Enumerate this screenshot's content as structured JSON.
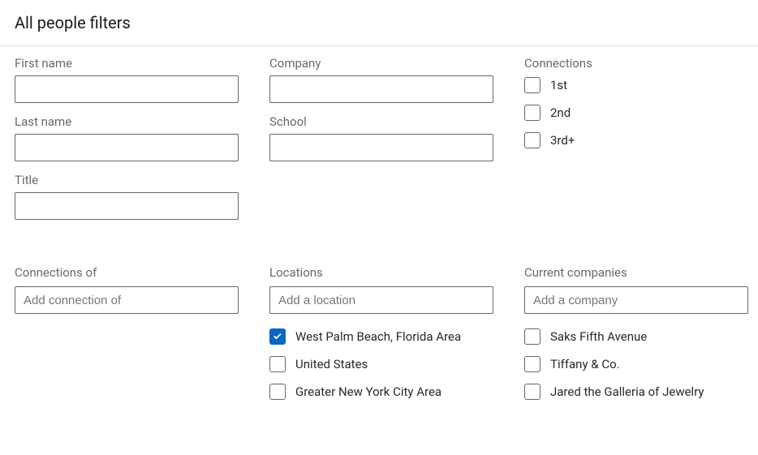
{
  "header": {
    "title": "All people filters"
  },
  "fields": {
    "first_name": {
      "label": "First name",
      "value": ""
    },
    "last_name": {
      "label": "Last name",
      "value": ""
    },
    "title": {
      "label": "Title",
      "value": ""
    },
    "company": {
      "label": "Company",
      "value": ""
    },
    "school": {
      "label": "School",
      "value": ""
    }
  },
  "connections": {
    "heading": "Connections",
    "options": [
      {
        "label": "1st",
        "checked": false
      },
      {
        "label": "2nd",
        "checked": false
      },
      {
        "label": "3rd+",
        "checked": false
      }
    ]
  },
  "connections_of": {
    "heading": "Connections of",
    "placeholder": "Add connection of"
  },
  "locations": {
    "heading": "Locations",
    "placeholder": "Add a location",
    "options": [
      {
        "label": "West Palm Beach, Florida Area",
        "checked": true
      },
      {
        "label": "United States",
        "checked": false
      },
      {
        "label": "Greater New York City Area",
        "checked": false
      }
    ]
  },
  "current_companies": {
    "heading": "Current companies",
    "placeholder": "Add a company",
    "options": [
      {
        "label": "Saks Fifth Avenue",
        "checked": false
      },
      {
        "label": "Tiffany & Co.",
        "checked": false
      },
      {
        "label": "Jared the Galleria of Jewelry",
        "checked": false
      }
    ]
  }
}
